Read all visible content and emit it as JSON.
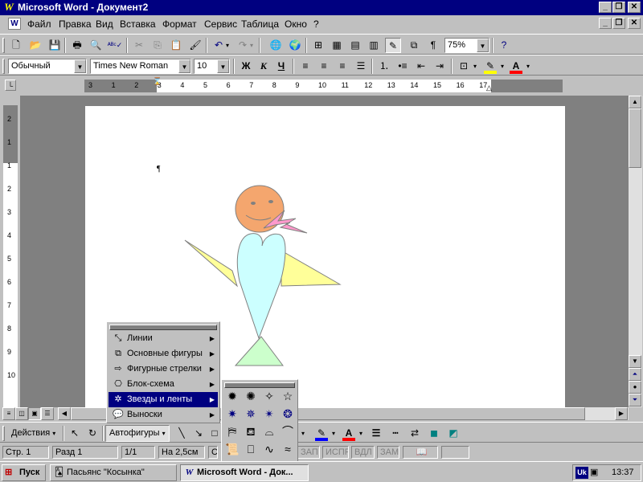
{
  "window": {
    "title": "Microsoft Word - Документ2"
  },
  "menus": [
    "Файл",
    "Правка",
    "Вид",
    "Вставка",
    "Формат",
    "Сервис",
    "Таблица",
    "Окно",
    "?"
  ],
  "standard_toolbar": {
    "zoom": "75%"
  },
  "formatting_toolbar": {
    "style": "Обычный",
    "font": "Times New Roman",
    "size": "10",
    "bold": "Ж",
    "italic": "К",
    "underline": "Ч"
  },
  "ruler": {
    "ticks": [
      "3",
      "1",
      "2",
      "3",
      "4",
      "5",
      "6",
      "7",
      "8",
      "9",
      "10",
      "11",
      "12",
      "13",
      "14",
      "15",
      "16",
      "17"
    ],
    "vticks": [
      "2",
      "1",
      "1",
      "2",
      "3",
      "4",
      "5",
      "6",
      "7",
      "8",
      "9",
      "10"
    ]
  },
  "autoshapes_menu": {
    "items": [
      {
        "label": "Линии",
        "icon": "lines-icon"
      },
      {
        "label": "Основные фигуры",
        "icon": "basic-shapes-icon"
      },
      {
        "label": "Фигурные стрелки",
        "icon": "block-arrows-icon"
      },
      {
        "label": "Блок-схема",
        "icon": "flowchart-icon"
      },
      {
        "label": "Звезды и ленты",
        "icon": "stars-banners-icon"
      },
      {
        "label": "Выноски",
        "icon": "callouts-icon"
      }
    ],
    "selected_index": 4
  },
  "drawing_toolbar": {
    "actions": "Действия",
    "autoshapes": "Автофигуры"
  },
  "status": {
    "page": "Стр. 1",
    "section": "Разд 1",
    "pages": "1/1",
    "at": "На 2,5см",
    "col": "С",
    "rec": "ЗАП",
    "trk": "ИСПР",
    "ext": "ВДЛ",
    "ovr": "ЗАМ"
  },
  "taskbar": {
    "start": "Пуск",
    "tasks": [
      "Пасьянс \"Косынка\"",
      "Microsoft Word - Док..."
    ],
    "lang": "Uk",
    "clock": "13:37"
  },
  "colors": {
    "titlebar": "#000080",
    "face": "#f4a66e",
    "body": "#ccffff",
    "arms": "#ffff99",
    "skirt": "#ccffcc",
    "beak": "#ff99cc",
    "highlight": "#ffff00",
    "font_color": "#ff0000"
  }
}
